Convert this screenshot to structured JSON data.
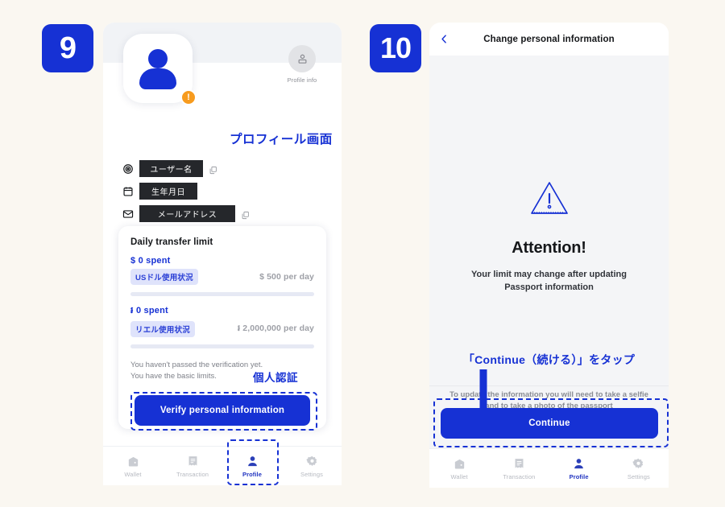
{
  "canvas": {
    "background": "#faf7f1",
    "accent_blue": "#1631d4",
    "chip_bg": "#dfe3fb",
    "redact_bg": "#25272b",
    "warn_orange": "#f79b1e"
  },
  "steps": [
    {
      "number": "9"
    },
    {
      "number": "10"
    }
  ],
  "left_screen": {
    "profile_info": {
      "icon": "profile-badge-icon",
      "label": "Profile info"
    },
    "avatar": {
      "icon": "person-avatar-icon",
      "alert_badge": "!"
    },
    "annotation_title": "プロフィール画面",
    "annotation_verify": "個人認証",
    "fields": [
      {
        "icon": "target-icon",
        "value": "ユーザー名",
        "copy": true
      },
      {
        "icon": "calendar-icon",
        "value": "生年月日",
        "copy": false
      },
      {
        "icon": "envelope-icon",
        "value": "メールアドレス",
        "copy": true
      }
    ],
    "limit_card": {
      "title": "Daily transfer limit",
      "rows": [
        {
          "spent": "$ 0 spent",
          "chip": "USドル使用状況",
          "per_day": "$ 500 per day",
          "progress_pct": 0
        },
        {
          "spent": "៛ 0 spent",
          "chip": "リエル使用状況",
          "per_day": "៛ 2,000,000 per day",
          "progress_pct": 0
        }
      ],
      "note_line1": "You haven't passed the verification yet.",
      "note_line2": "You have the basic limits.",
      "cta_label": "Verify personal information"
    },
    "nav": [
      {
        "icon": "wallet-icon",
        "label": "Wallet",
        "active": false
      },
      {
        "icon": "receipt-icon",
        "label": "Transaction",
        "active": false
      },
      {
        "icon": "person-icon",
        "label": "Profile",
        "active": true
      },
      {
        "icon": "gear-icon",
        "label": "Settings",
        "active": false
      }
    ]
  },
  "right_screen": {
    "back_icon": "chevron-left-icon",
    "title": "Change personal information",
    "warning_icon": "warning-triangle-icon",
    "heading": "Attention!",
    "subtitle_line1": "Your limit may change after updating",
    "subtitle_line2": "Passport information",
    "annotation_continue": "「Continue（続ける）」をタップ",
    "arrow_icon": "arrow-down-icon",
    "helper_line1": "To update the information you will need",
    "helper_line2": "to take a selfie and to take a photo of the",
    "helper_line3": "passport",
    "cta_label": "Continue",
    "nav": [
      {
        "icon": "wallet-icon",
        "label": "Wallet",
        "active": false
      },
      {
        "icon": "receipt-icon",
        "label": "Transaction",
        "active": false
      },
      {
        "icon": "person-icon",
        "label": "Profile",
        "active": true
      },
      {
        "icon": "gear-icon",
        "label": "Settings",
        "active": false
      }
    ]
  }
}
